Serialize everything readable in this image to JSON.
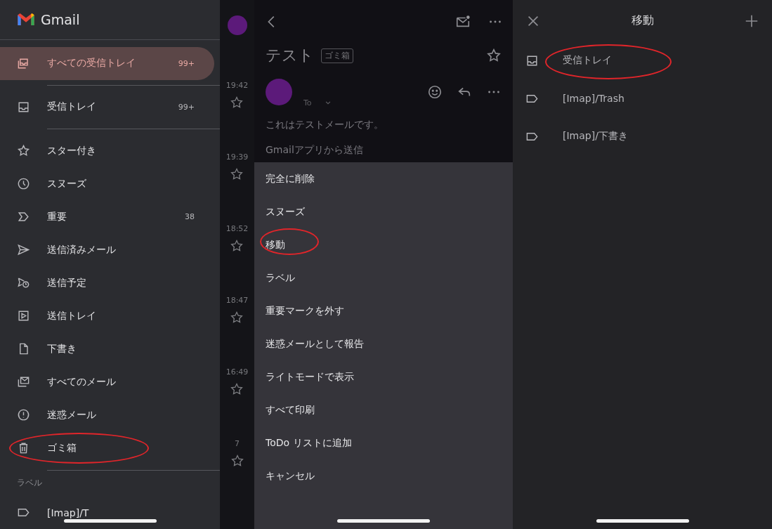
{
  "drawer": {
    "app_name": "Gmail",
    "items": [
      {
        "label": "すべての受信トレイ",
        "count": "99+",
        "selected": true,
        "highlighted": false
      },
      {
        "label": "受信トレイ",
        "count": "99+",
        "selected": false,
        "highlighted": false
      },
      {
        "label": "スター付き",
        "selected": false,
        "highlighted": false
      },
      {
        "label": "スヌーズ",
        "selected": false,
        "highlighted": false
      },
      {
        "label": "重要",
        "count": "38",
        "selected": false,
        "highlighted": false
      },
      {
        "label": "送信済みメール",
        "selected": false,
        "highlighted": false
      },
      {
        "label": "送信予定",
        "selected": false,
        "highlighted": false
      },
      {
        "label": "送信トレイ",
        "selected": false,
        "highlighted": false
      },
      {
        "label": "下書き",
        "selected": false,
        "highlighted": false
      },
      {
        "label": "すべてのメール",
        "selected": false,
        "highlighted": false
      },
      {
        "label": "迷惑メール",
        "selected": false,
        "highlighted": false
      },
      {
        "label": "ゴミ箱",
        "selected": false,
        "highlighted": true
      }
    ],
    "section_label": "ラベル",
    "labels": [
      {
        "label": "[Imap]/T"
      }
    ]
  },
  "mail_list": {
    "times": [
      "19:42",
      "19:39",
      "18:52",
      "18:47",
      "16:49",
      "7"
    ]
  },
  "message": {
    "subject": "テスト",
    "folder_tag": "ゴミ箱",
    "recipient_label": "To",
    "body": "これはテストメールです。",
    "signature": "Gmailアプリから送信"
  },
  "action_sheet": {
    "items": [
      {
        "label": "完全に削除",
        "highlighted": false
      },
      {
        "label": "スヌーズ",
        "highlighted": false
      },
      {
        "label": "移動",
        "highlighted": true
      },
      {
        "label": "ラベル",
        "highlighted": false
      },
      {
        "label": "重要マークを外す",
        "highlighted": false
      },
      {
        "label": "迷惑メールとして報告",
        "highlighted": false
      },
      {
        "label": "ライトモードで表示",
        "highlighted": false
      },
      {
        "label": "すべて印刷",
        "highlighted": false
      },
      {
        "label": "ToDo リストに追加",
        "highlighted": false
      },
      {
        "label": "キャンセル",
        "highlighted": false
      }
    ]
  },
  "move_dialog": {
    "title": "移動",
    "folders": [
      {
        "label": "受信トレイ",
        "highlighted": true
      },
      {
        "label": "[Imap]/Trash",
        "highlighted": false
      },
      {
        "label": "[Imap]/下書き",
        "highlighted": false
      }
    ]
  }
}
